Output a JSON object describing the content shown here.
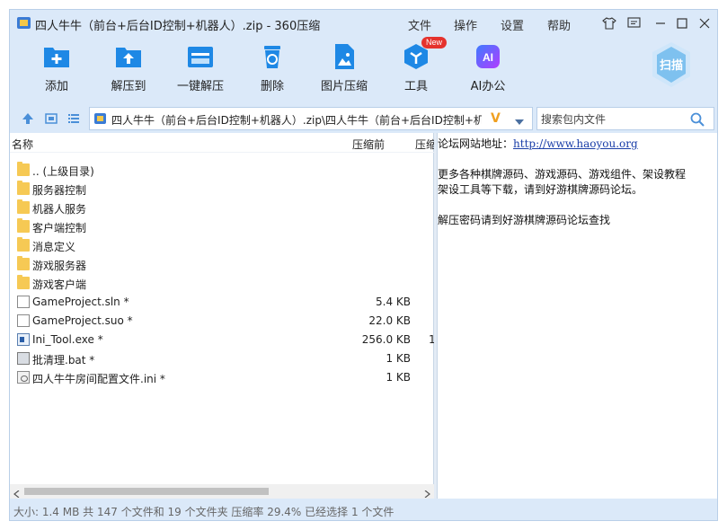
{
  "window": {
    "title": "四人牛牛（前台+后台ID控制+机器人）.zip - 360压缩"
  },
  "menu": {
    "file": "文件",
    "operate": "操作",
    "settings": "设置",
    "help": "帮助"
  },
  "toolbar": {
    "add": "添加",
    "extract_to": "解压到",
    "one_click_extract": "一键解压",
    "delete": "删除",
    "image_compress": "图片压缩",
    "tools": "工具",
    "tools_badge": "New",
    "ai_office": "AI办公",
    "ai_icon_text": "AI",
    "scan": "扫描"
  },
  "address": {
    "path": "四人牛牛（前台+后台ID控制+机器人）.zip\\四人牛牛（前台+后台ID控制+机器",
    "logo": "V"
  },
  "search": {
    "placeholder": "搜索包内文件"
  },
  "list": {
    "columns": {
      "name": "名称",
      "before": "压缩前",
      "after": "压缩"
    },
    "rows": [
      {
        "name": ".. (上级目录)",
        "size": "",
        "extra": "",
        "icon": "folder-icon"
      },
      {
        "name": "服务器控制",
        "size": "",
        "extra": "",
        "icon": "folder-icon"
      },
      {
        "name": "机器人服务",
        "size": "",
        "extra": "",
        "icon": "folder-icon"
      },
      {
        "name": "客户端控制",
        "size": "",
        "extra": "",
        "icon": "folder-icon"
      },
      {
        "name": "消息定义",
        "size": "",
        "extra": "",
        "icon": "folder-icon"
      },
      {
        "name": "游戏服务器",
        "size": "",
        "extra": "",
        "icon": "folder-icon"
      },
      {
        "name": "游戏客户端",
        "size": "",
        "extra": "",
        "icon": "folder-icon"
      },
      {
        "name": "GameProject.sln *",
        "size": "5.4 KB",
        "extra": "",
        "icon": "document-icon"
      },
      {
        "name": "GameProject.suo *",
        "size": "22.0 KB",
        "extra": "",
        "icon": "document-icon"
      },
      {
        "name": "Ini_Tool.exe *",
        "size": "256.0 KB",
        "extra": "1",
        "icon": "executable-icon"
      },
      {
        "name": "批清理.bat *",
        "size": "1 KB",
        "extra": "",
        "icon": "batch-file-icon"
      },
      {
        "name": "四人牛牛房间配置文件.ini *",
        "size": "1 KB",
        "extra": "",
        "icon": "ini-file-icon"
      }
    ]
  },
  "comment": {
    "site_label": "论坛网站地址：",
    "site_url": "http://www.haoyou.org",
    "line2": "更多各种棋牌源码、游戏源码、游戏组件、架设教程",
    "line3": "架设工具等下载，请到好游棋牌源码论坛。",
    "line4": "解压密码请到好游棋牌源码论坛查找"
  },
  "status": {
    "text": "大小: 1.4 MB 共 147 个文件和 19 个文件夹 压缩率 29.4% 已经选择 1 个文件"
  },
  "colors": {
    "accent": "#1e88e5",
    "frame": "#dbe9f9",
    "folder": "#f6c954",
    "new_badge": "#e5322d"
  }
}
